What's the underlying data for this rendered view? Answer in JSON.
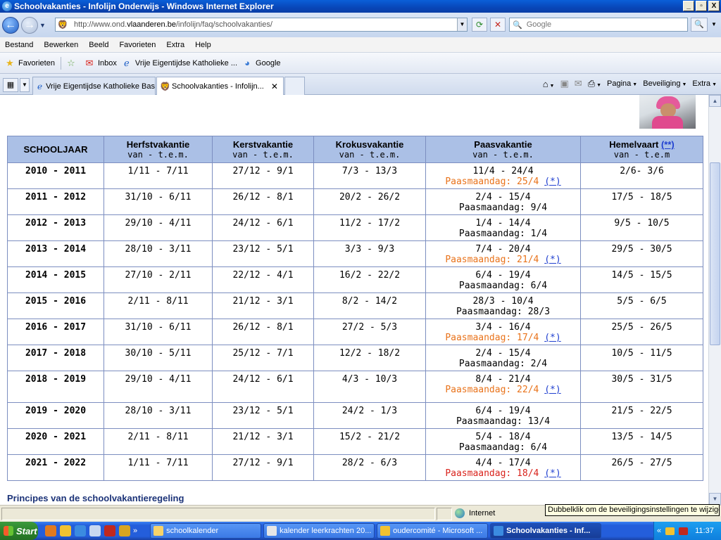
{
  "window": {
    "title": "Schoolvakanties - Infolijn Onderwijs - Windows Internet Explorer",
    "buttons": [
      "_",
      "▫",
      "X"
    ]
  },
  "address": {
    "url_prefix": "http://www.ond.",
    "url_domain": "vlaanderen.be",
    "url_path": "/infolijn/faq/schoolvakanties/",
    "search_placeholder": "Google"
  },
  "menu": [
    "Bestand",
    "Bewerken",
    "Beeld",
    "Favorieten",
    "Extra",
    "Help"
  ],
  "favorites": {
    "label": "Favorieten",
    "items": [
      "Inbox",
      "Vrije Eigentijdse Katholieke ...",
      "Google"
    ]
  },
  "tabs": [
    {
      "label": "Vrije Eigentijdse Katholieke Bas"
    },
    {
      "label": "Schoolvakanties - Infolijn..."
    }
  ],
  "commands": {
    "page": "Pagina",
    "security": "Beveiliging",
    "extra": "Extra"
  },
  "table": {
    "headers": [
      {
        "title": "SCHOOLJAAR",
        "sub": ""
      },
      {
        "title": "Herfstvakantie",
        "sub": "van - t.e.m."
      },
      {
        "title": "Kerstvakantie",
        "sub": "van - t.e.m."
      },
      {
        "title": "Krokusvakantie",
        "sub": "van - t.e.m."
      },
      {
        "title": "Paasvakantie",
        "sub": "van - t.e.m."
      },
      {
        "title": "Hemelvaart",
        "sub": "van - t.e.m",
        "link": "(**)"
      }
    ],
    "rows": [
      {
        "year": "2010 - 2011",
        "herfst": "1/11 - 7/11",
        "kerst": "27/12 - 9/1",
        "krokus": "7/3 - 13/3",
        "paas": "11/4 - 24/4",
        "paasmaandag": "Paasmaandag: 25/4",
        "pm_style": "orange",
        "pm_link": "(*)",
        "hemel": "2/6- 3/6"
      },
      {
        "year": "2011 - 2012",
        "herfst": "31/10 - 6/11",
        "kerst": "26/12 - 8/1",
        "krokus": "20/2 - 26/2",
        "paas": "2/4 - 15/4",
        "paasmaandag": "Paasmaandag: 9/4",
        "pm_style": "plain",
        "pm_link": "",
        "hemel": "17/5 - 18/5"
      },
      {
        "year": "2012 - 2013",
        "herfst": "29/10 - 4/11",
        "kerst": "24/12 - 6/1",
        "krokus": "11/2 - 17/2",
        "paas": "1/4 - 14/4",
        "paasmaandag": "Paasmaandag: 1/4",
        "pm_style": "plain",
        "pm_link": "",
        "hemel": "9/5 - 10/5"
      },
      {
        "year": "2013 - 2014",
        "herfst": "28/10 - 3/11",
        "kerst": "23/12 - 5/1",
        "krokus": "3/3 - 9/3",
        "paas": "7/4 - 20/4",
        "paasmaandag": "Paasmaandag: 21/4",
        "pm_style": "orange",
        "pm_link": "(*)",
        "hemel": "29/5 - 30/5"
      },
      {
        "year": "2014 - 2015",
        "herfst": "27/10 - 2/11",
        "kerst": "22/12 - 4/1",
        "krokus": "16/2 - 22/2",
        "paas": "6/4 - 19/4",
        "paasmaandag": "Paasmaandag:  6/4",
        "pm_style": "plain",
        "pm_link": "",
        "hemel": "14/5 - 15/5"
      },
      {
        "year": "2015 - 2016",
        "herfst": "2/11 - 8/11",
        "kerst": "21/12 - 3/1",
        "krokus": "8/2 - 14/2",
        "paas": "28/3 - 10/4",
        "paasmaandag": "Paasmaandag:  28/3",
        "pm_style": "plain",
        "pm_link": "",
        "hemel": "5/5 - 6/5"
      },
      {
        "year": "2016 - 2017",
        "herfst": "31/10 - 6/11",
        "kerst": "26/12 - 8/1",
        "krokus": "27/2 - 5/3",
        "paas": "3/4 - 16/4",
        "paasmaandag": "Paasmaandag: 17/4",
        "pm_style": "orange",
        "pm_link": "(*)",
        "hemel": "25/5 - 26/5"
      },
      {
        "year": "2017 - 2018",
        "herfst": "30/10 - 5/11",
        "kerst": "25/12 - 7/1",
        "krokus": "12/2 - 18/2",
        "paas": "2/4 - 15/4",
        "paasmaandag": "Paasmaandag:  2/4",
        "pm_style": "plain",
        "pm_link": "",
        "hemel": "10/5 - 11/5"
      },
      {
        "year": "2018 - 2019",
        "herfst": "29/10 - 4/11",
        "kerst": "24/12 - 6/1",
        "krokus": "4/3 - 10/3",
        "paas": "8/4 - 21/4",
        "paasmaandag": "Paasmaandag: 22/4",
        "pm_style": "orange",
        "pm_link": "(*)",
        "hemel": "30/5 - 31/5"
      },
      {
        "year": "2019 - 2020",
        "herfst": "28/10 - 3/11",
        "kerst": "23/12 - 5/1",
        "krokus": "24/2 - 1/3",
        "paas": "6/4 - 19/4",
        "paasmaandag": "Paasmaandag:  13/4",
        "pm_style": "plain",
        "pm_link": "",
        "hemel": "21/5 - 22/5"
      },
      {
        "year": "2020 - 2021",
        "herfst": "2/11 - 8/11",
        "kerst": "21/12 - 3/1",
        "krokus": "15/2 - 21/2",
        "paas": "5/4 - 18/4",
        "paasmaandag": "Paasmaandag: 6/4",
        "pm_style": "plain",
        "pm_link": "",
        "hemel": "13/5 - 14/5"
      },
      {
        "year": "2021 - 2022",
        "herfst": "1/11 - 7/11",
        "kerst": "27/12 - 9/1",
        "krokus": "28/2 - 6/3",
        "paas": "4/4 - 17/4",
        "paasmaandag": "Paasmaandag: 18/4",
        "pm_style": "red",
        "pm_link": "(*)",
        "hemel": "26/5 - 27/5"
      }
    ]
  },
  "section_heading": "Principes van de schoolvakantieregeling",
  "status": {
    "zone": "Internet",
    "tooltip": "Dubbelklik om de beveiligingsinstellingen te wijzigen"
  },
  "taskbar": {
    "start": "Start",
    "more": "»",
    "tasks": [
      {
        "label": "schoolkalender",
        "active": false
      },
      {
        "label": "kalender leerkrachten 20...",
        "active": false
      },
      {
        "label": "oudercomité - Microsoft ...",
        "active": false
      },
      {
        "label": "Schoolvakanties - Inf...",
        "active": true
      }
    ],
    "tray_arrow": "«",
    "clock": "11:37"
  },
  "colors": {
    "header_bg": "#abc0e6",
    "paasmaandag_orange": "#e9731b",
    "paasmaandag_red": "#d9231c",
    "link": "#1f3fd0"
  }
}
